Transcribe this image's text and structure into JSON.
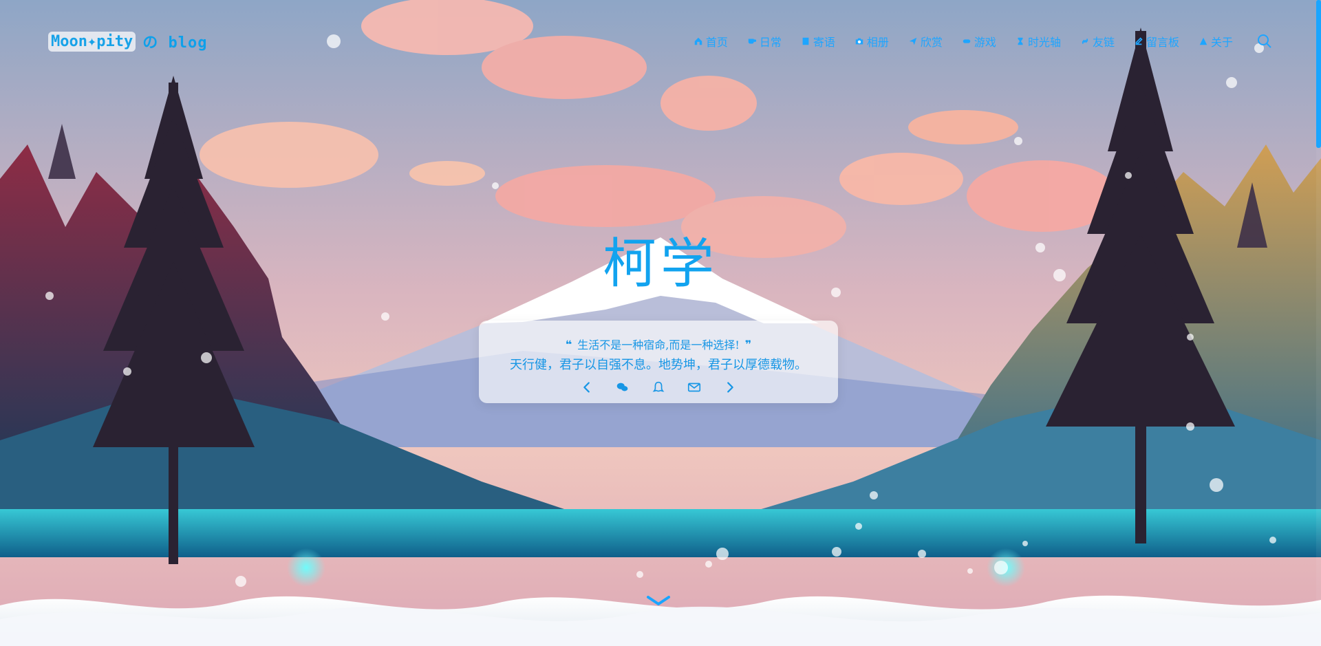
{
  "site": {
    "logo_chip": "Moon✦pity",
    "logo_suffix": "の blog"
  },
  "nav": [
    {
      "label": "首页",
      "icon": "home-icon"
    },
    {
      "label": "日常",
      "icon": "coffee-icon"
    },
    {
      "label": "寄语",
      "icon": "note-icon"
    },
    {
      "label": "相册",
      "icon": "camera-icon"
    },
    {
      "label": "欣赏",
      "icon": "send-icon"
    },
    {
      "label": "游戏",
      "icon": "gamepad-icon"
    },
    {
      "label": "时光轴",
      "icon": "hourglass-icon"
    },
    {
      "label": "友链",
      "icon": "link-icon"
    },
    {
      "label": "留言板",
      "icon": "edit-icon"
    },
    {
      "label": "关于",
      "icon": "warning-icon"
    }
  ],
  "hero": {
    "title": "柯学",
    "motto": "生活不是一种宿命,而是一种选择!",
    "sentence": "天行健，君子以自强不息。地势坤，君子以厚德载物。"
  },
  "colors": {
    "accent": "#1aa5ff"
  }
}
